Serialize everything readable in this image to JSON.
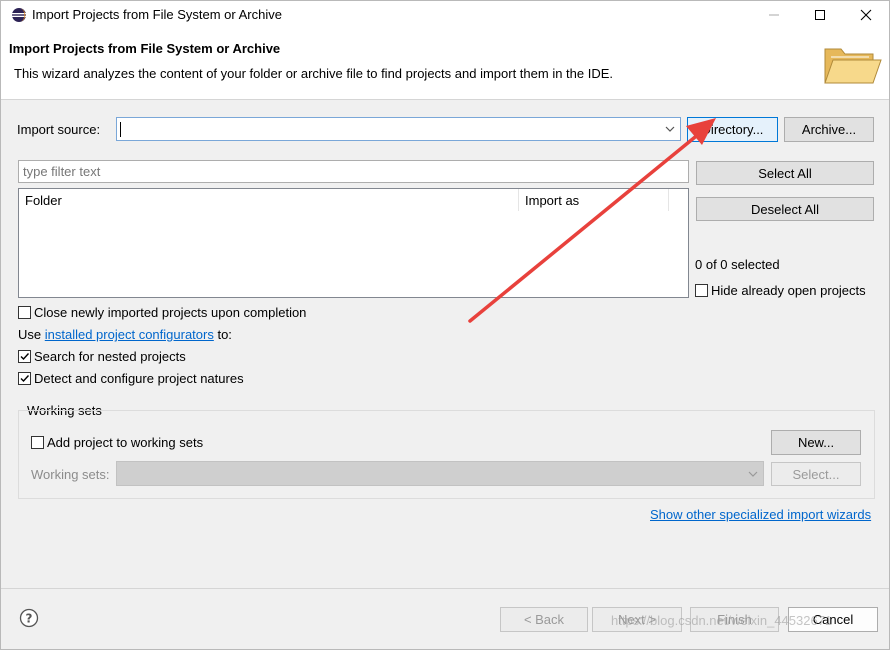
{
  "window": {
    "title": "Import Projects from File System or Archive"
  },
  "header": {
    "title": "Import Projects from File System or Archive",
    "description": "This wizard analyzes the content of your folder or archive file to find projects and import them in the IDE."
  },
  "import_source": {
    "label": "Import source:",
    "value": "",
    "directory_button": "Directory...",
    "archive_button": "Archive..."
  },
  "filter": {
    "placeholder": "type filter text"
  },
  "table": {
    "columns": [
      "Folder",
      "Import as"
    ]
  },
  "selection": {
    "select_all": "Select All",
    "deselect_all": "Deselect All",
    "count_text": "0 of 0 selected"
  },
  "options": {
    "hide_open": {
      "label": "Hide already open projects",
      "checked": false
    },
    "close_imported": {
      "label": "Close newly imported projects upon completion",
      "checked": false
    },
    "use_prefix": "Use",
    "configurators_link": "installed project configurators",
    "use_suffix": "to:",
    "search_nested": {
      "label": "Search for nested projects",
      "checked": true
    },
    "detect_natures": {
      "label": "Detect and configure project natures",
      "checked": true
    }
  },
  "working_sets": {
    "group_label": "Working sets",
    "add_label": "Add project to working sets",
    "add_checked": false,
    "new_button": "New...",
    "sets_label": "Working sets:",
    "select_button": "Select..."
  },
  "wizards_link": "Show other specialized import wizards",
  "footer": {
    "back": "< Back",
    "next": "Next >",
    "finish": "Finish",
    "cancel": "Cancel"
  },
  "watermark": "https://blog.csdn.net/weixin_44532671",
  "colors": {
    "accent": "#0078d7",
    "link": "#0066cc",
    "annotation_arrow": "#e8413c"
  }
}
